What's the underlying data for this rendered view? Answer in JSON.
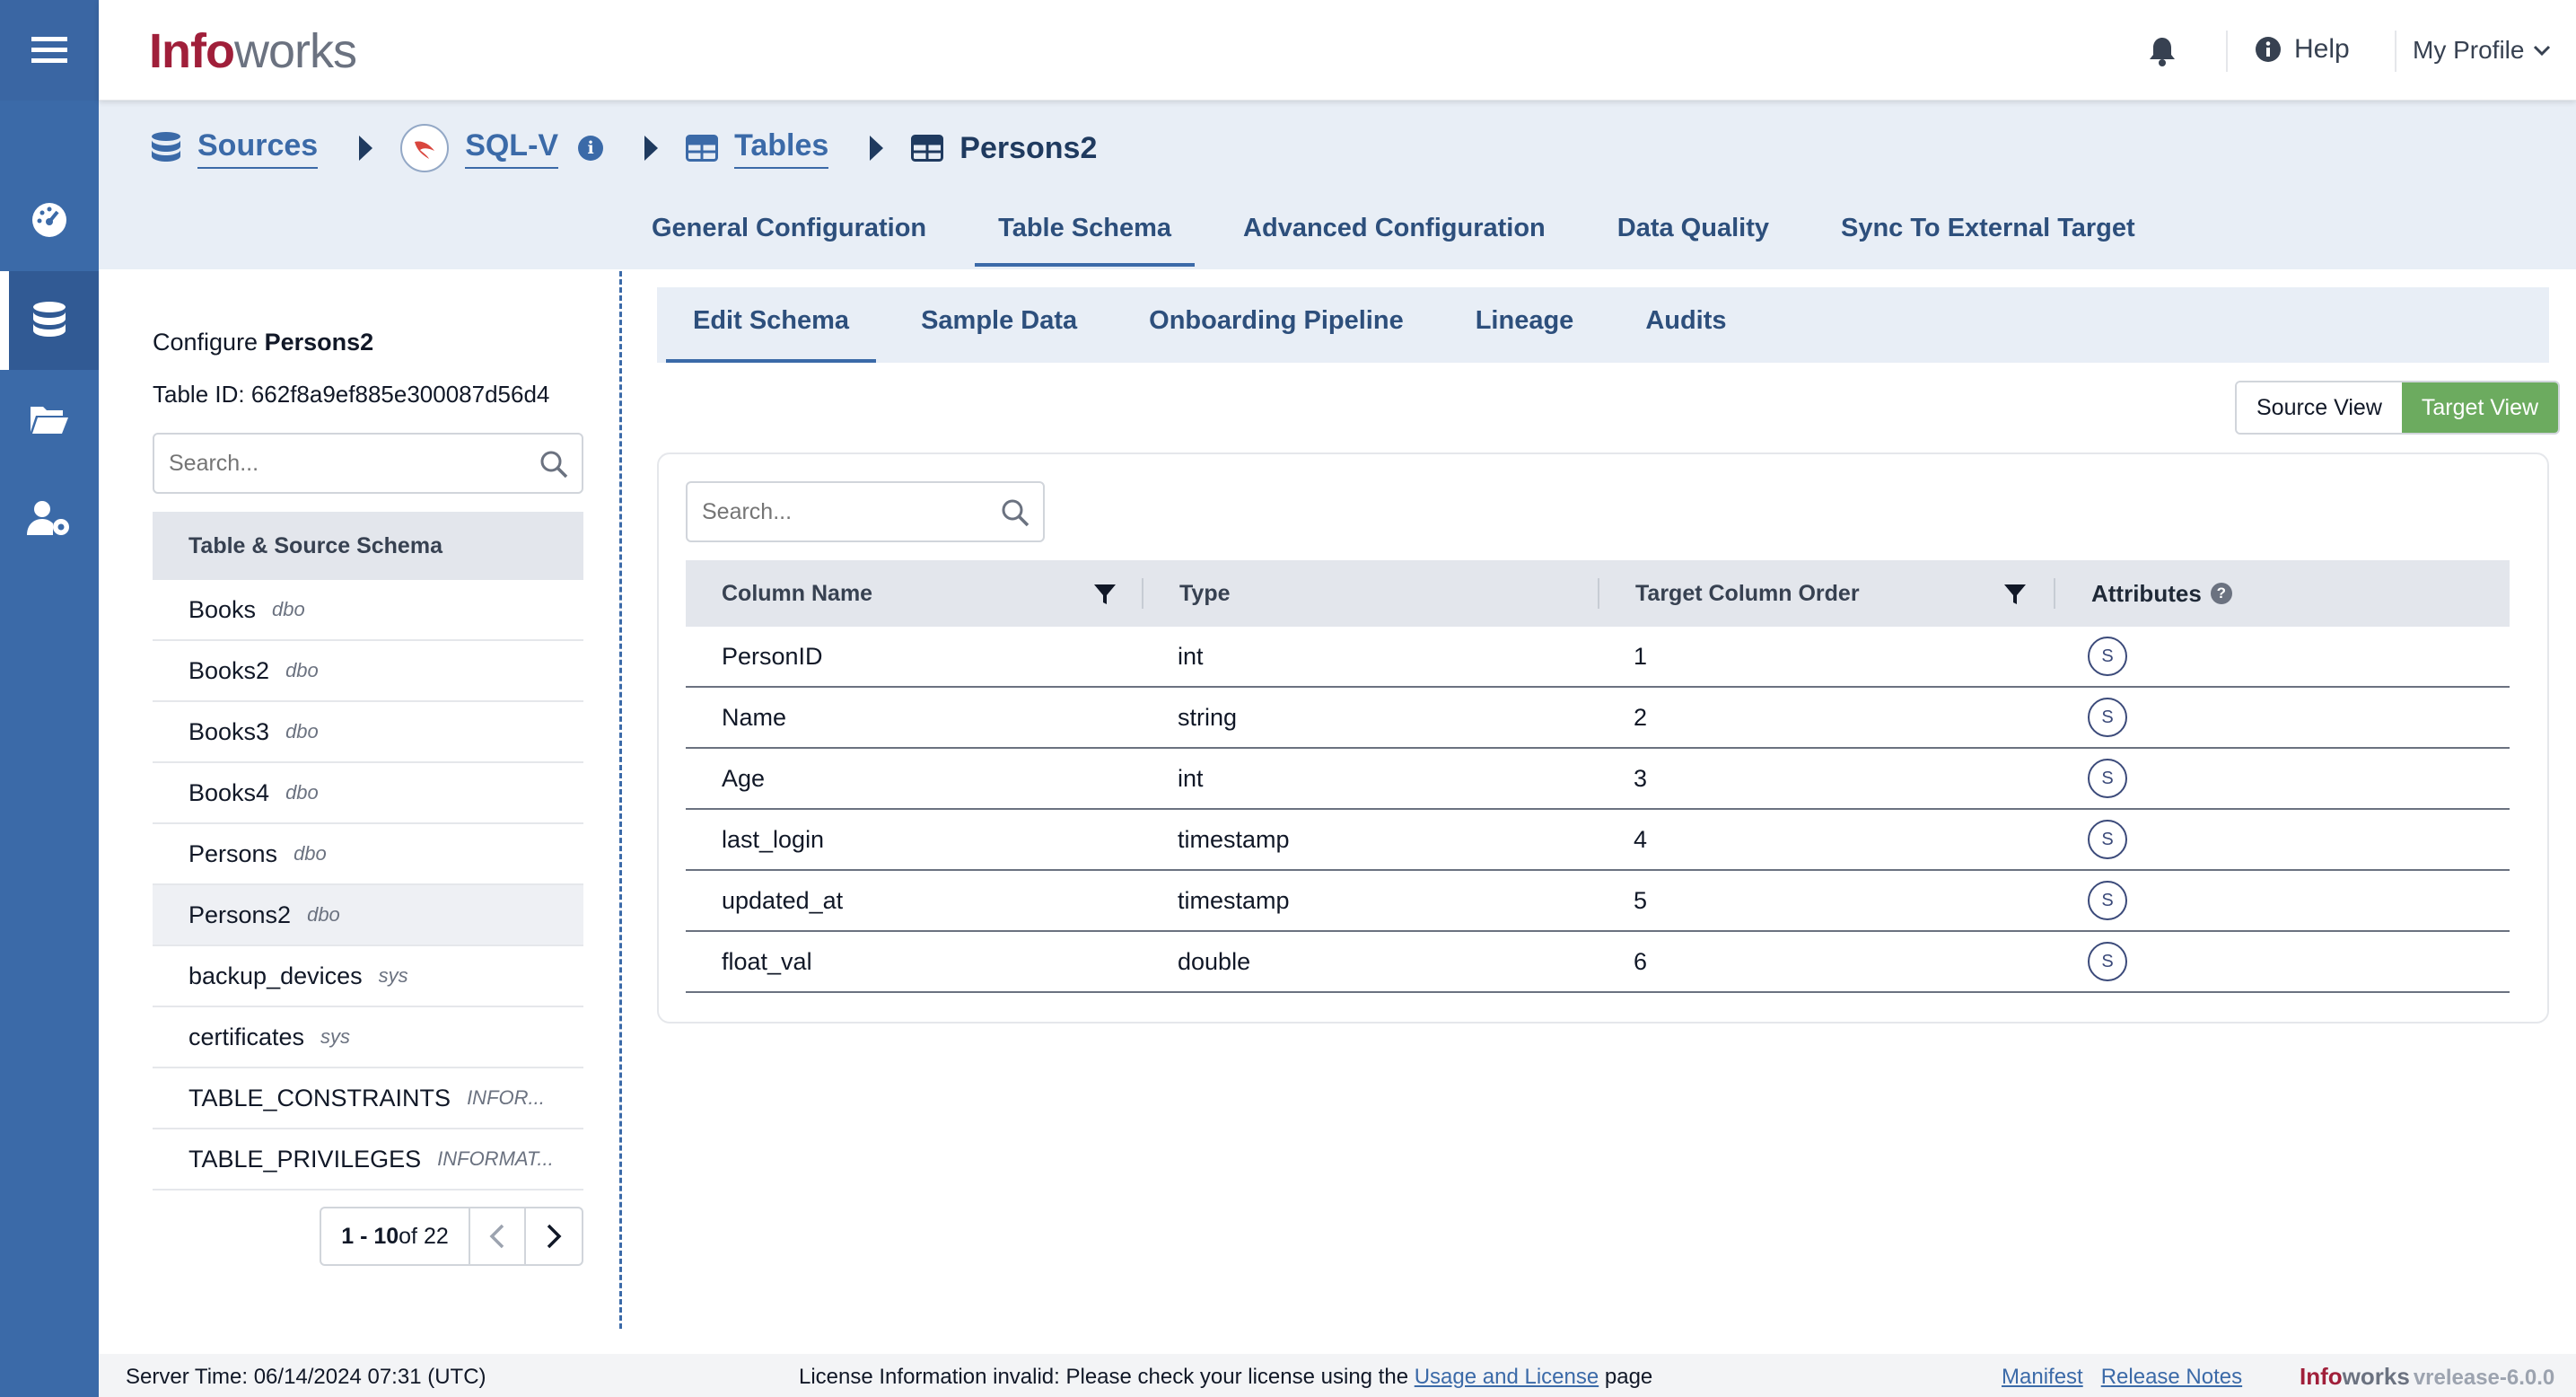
{
  "app": {
    "logo_brand": "Info",
    "logo_rest": "works",
    "help_label": "Help",
    "profile_label": "My Profile"
  },
  "breadcrumb": {
    "sources": "Sources",
    "source_name": "SQL-V",
    "info_icon_glyph": "i",
    "tables": "Tables",
    "current": "Persons2"
  },
  "main_tabs": [
    {
      "label": "General Configuration"
    },
    {
      "label": "Table Schema"
    },
    {
      "label": "Advanced Configuration"
    },
    {
      "label": "Data Quality"
    },
    {
      "label": "Sync To External Target"
    }
  ],
  "left_panel": {
    "configure_prefix": "Configure ",
    "configure_table": "Persons2",
    "table_id": "Table ID: 662f8a9ef885e300087d56d4",
    "search_placeholder": "Search...",
    "list_header": "Table & Source Schema",
    "tables": [
      {
        "name": "Books",
        "schema": "dbo"
      },
      {
        "name": "Books2",
        "schema": "dbo"
      },
      {
        "name": "Books3",
        "schema": "dbo"
      },
      {
        "name": "Books4",
        "schema": "dbo"
      },
      {
        "name": "Persons",
        "schema": "dbo"
      },
      {
        "name": "Persons2",
        "schema": "dbo"
      },
      {
        "name": "backup_devices",
        "schema": "sys"
      },
      {
        "name": "certificates",
        "schema": "sys"
      },
      {
        "name": "TABLE_CONSTRAINTS",
        "schema": "INFOR..."
      },
      {
        "name": "TABLE_PRIVILEGES",
        "schema": "INFORMAT..."
      }
    ],
    "pager": {
      "range": "1 - 10",
      "of": " of 22"
    }
  },
  "sub_tabs": [
    {
      "label": "Edit Schema"
    },
    {
      "label": "Sample Data"
    },
    {
      "label": "Onboarding Pipeline"
    },
    {
      "label": "Lineage"
    },
    {
      "label": "Audits"
    }
  ],
  "view_toggle": {
    "source": "Source View",
    "target": "Target View"
  },
  "schema_table": {
    "search_placeholder": "Search...",
    "headers": {
      "column_name": "Column Name",
      "type": "Type",
      "target_order": "Target Column Order",
      "attributes": "Attributes",
      "attributes_help_glyph": "?"
    },
    "rows": [
      {
        "name": "PersonID",
        "type": "int",
        "order": "1",
        "attr": "S"
      },
      {
        "name": "Name",
        "type": "string",
        "order": "2",
        "attr": "S"
      },
      {
        "name": "Age",
        "type": "int",
        "order": "3",
        "attr": "S"
      },
      {
        "name": "last_login",
        "type": "timestamp",
        "order": "4",
        "attr": "S"
      },
      {
        "name": "updated_at",
        "type": "timestamp",
        "order": "5",
        "attr": "S"
      },
      {
        "name": "float_val",
        "type": "double",
        "order": "6",
        "attr": "S"
      }
    ]
  },
  "footer": {
    "server_time": "Server Time: 06/14/2024 07:31 (UTC)",
    "license_prefix": "License Information invalid: Please check your license using the ",
    "license_link": "Usage and License",
    "license_suffix": " page",
    "manifest": "Manifest",
    "release_notes": "Release Notes",
    "brand_info": "Info",
    "brand_works": "works",
    "version": "vrelease-6.0.0"
  },
  "colors": {
    "rail": "#3b6aa8",
    "accent": "#3b6aa8",
    "brand": "#a01f3a",
    "target_view": "#6cab5f"
  }
}
